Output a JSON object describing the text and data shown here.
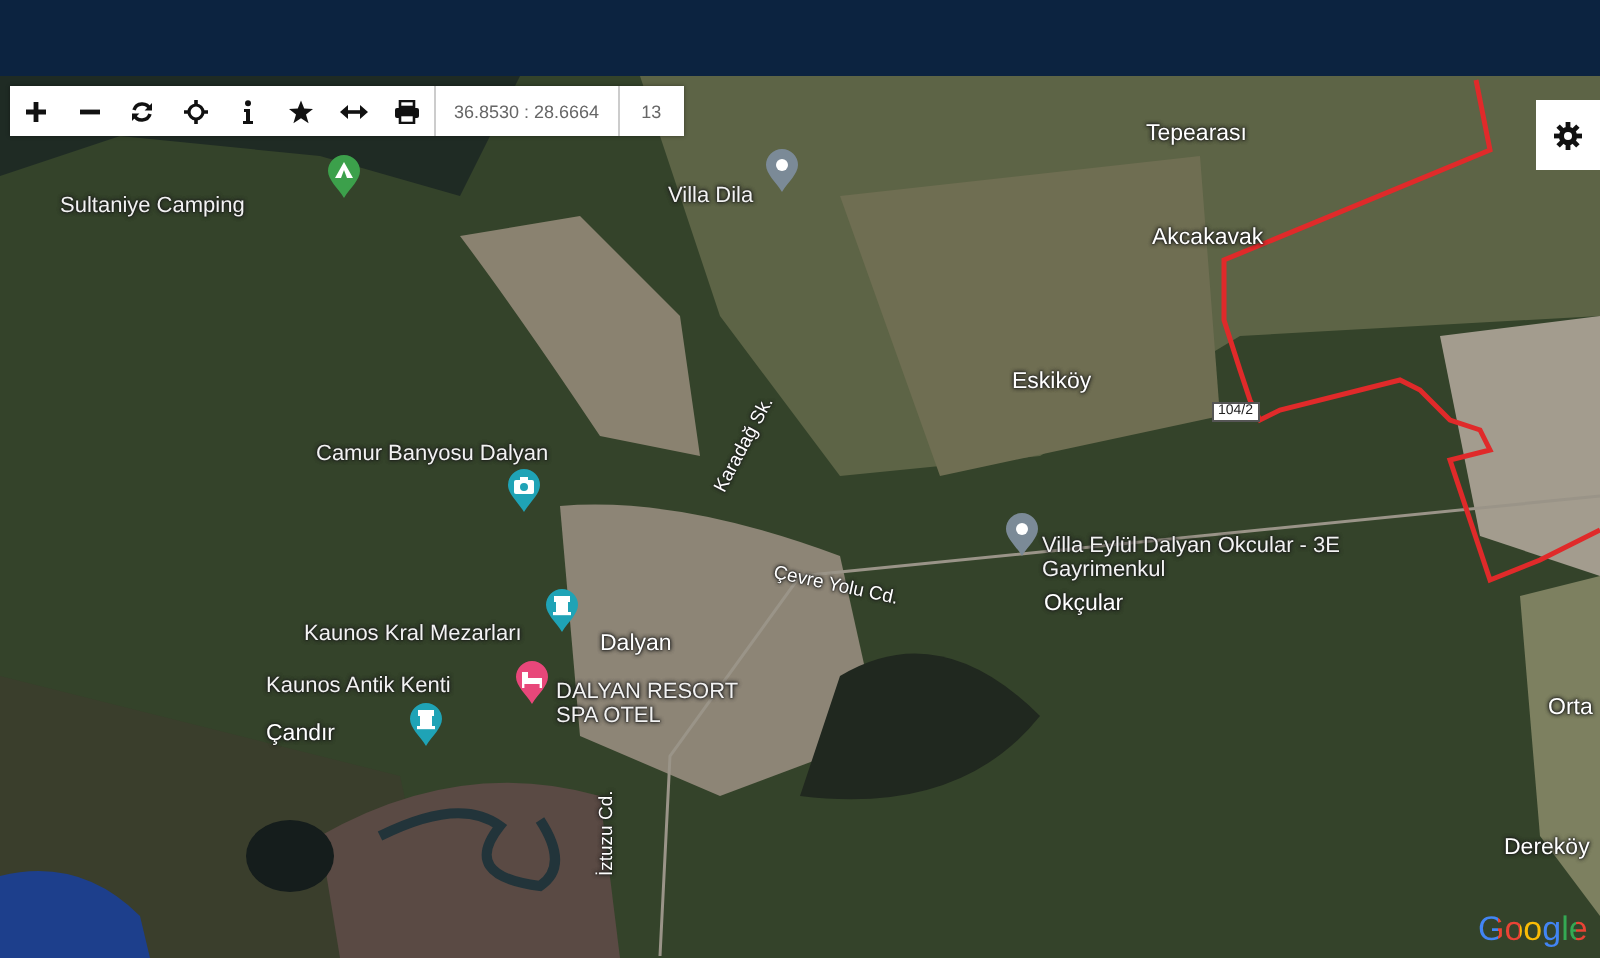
{
  "toolbar": {
    "coordinates": "36.8530 : 28.6664",
    "zoom": "13"
  },
  "map_labels": [
    {
      "kind": "pin",
      "text": "Sultaniye Camping",
      "color": "#3ca04b"
    },
    {
      "kind": "pin",
      "text": "Villa Dila",
      "color": "#7b8a97"
    },
    {
      "kind": "place",
      "text": "Tepearası"
    },
    {
      "kind": "place",
      "text": "Akcakavak"
    },
    {
      "kind": "place",
      "text": "Eskiköy"
    },
    {
      "kind": "pin",
      "text": "Camur Banyosu Dalyan",
      "color": "#1fa3b6"
    },
    {
      "kind": "road",
      "text": "Karadağ Sk."
    },
    {
      "kind": "road",
      "text": "Çevre Yolu Cd."
    },
    {
      "kind": "pin",
      "text": "Villa Eylül Dalyan Okcular - 3E Gayrimenkul",
      "color": "#7b8a97"
    },
    {
      "kind": "place",
      "text": "Okçular"
    },
    {
      "kind": "pin",
      "text": "Kaunos Kral Mezarları",
      "color": "#1fa3b6"
    },
    {
      "kind": "place",
      "text": "Dalyan"
    },
    {
      "kind": "pin",
      "text": "Kaunos Antik Kenti",
      "color": "#1fa3b6"
    },
    {
      "kind": "pin",
      "text": "DALYAN RESORT SPA OTEL",
      "color": "#e8477a"
    },
    {
      "kind": "place",
      "text": "Çandır"
    },
    {
      "kind": "place",
      "text": "Orta"
    },
    {
      "kind": "place",
      "text": "Dereköy"
    },
    {
      "kind": "road",
      "text": "İztuzu Cd."
    }
  ],
  "route_shield": "104/2",
  "attribution_logo": "Google"
}
